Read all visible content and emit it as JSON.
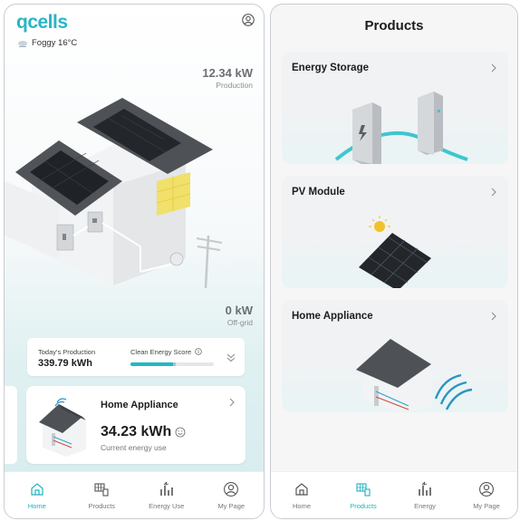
{
  "home": {
    "logo": "qcells",
    "weather": "Foggy 16°C",
    "production": {
      "value": "12.34 kW",
      "label": "Production"
    },
    "offgrid": {
      "value": "0 kW",
      "label": "Off-grid"
    },
    "summary": {
      "today_label": "Today's Production",
      "today_value": "339.79 kWh",
      "score_label": "Clean Energy Score",
      "score_fraction": 0.51
    },
    "appliance_card": {
      "title": "Home Appliance",
      "value": "34.23 kWh",
      "subtitle": "Current energy use"
    }
  },
  "products_page": {
    "title": "Products",
    "items": [
      {
        "label": "Energy Storage"
      },
      {
        "label": "PV Module"
      },
      {
        "label": "Home Appliance"
      }
    ]
  },
  "tabs_left": [
    {
      "label": "Home",
      "icon": "home-icon",
      "active": true
    },
    {
      "label": "Products",
      "icon": "products-icon",
      "active": false
    },
    {
      "label": "Energy Use",
      "icon": "energy-icon",
      "active": false
    },
    {
      "label": "My Page",
      "icon": "user-icon",
      "active": false
    }
  ],
  "tabs_right": [
    {
      "label": "Home",
      "icon": "home-icon",
      "active": false
    },
    {
      "label": "Products",
      "icon": "products-icon",
      "active": true
    },
    {
      "label": "Energy",
      "icon": "energy-icon",
      "active": false
    },
    {
      "label": "My Page",
      "icon": "user-icon",
      "active": false
    }
  ],
  "colors": {
    "accent": "#20b9c4",
    "brand": "#29b5c3",
    "background": "#f6f6f7"
  }
}
